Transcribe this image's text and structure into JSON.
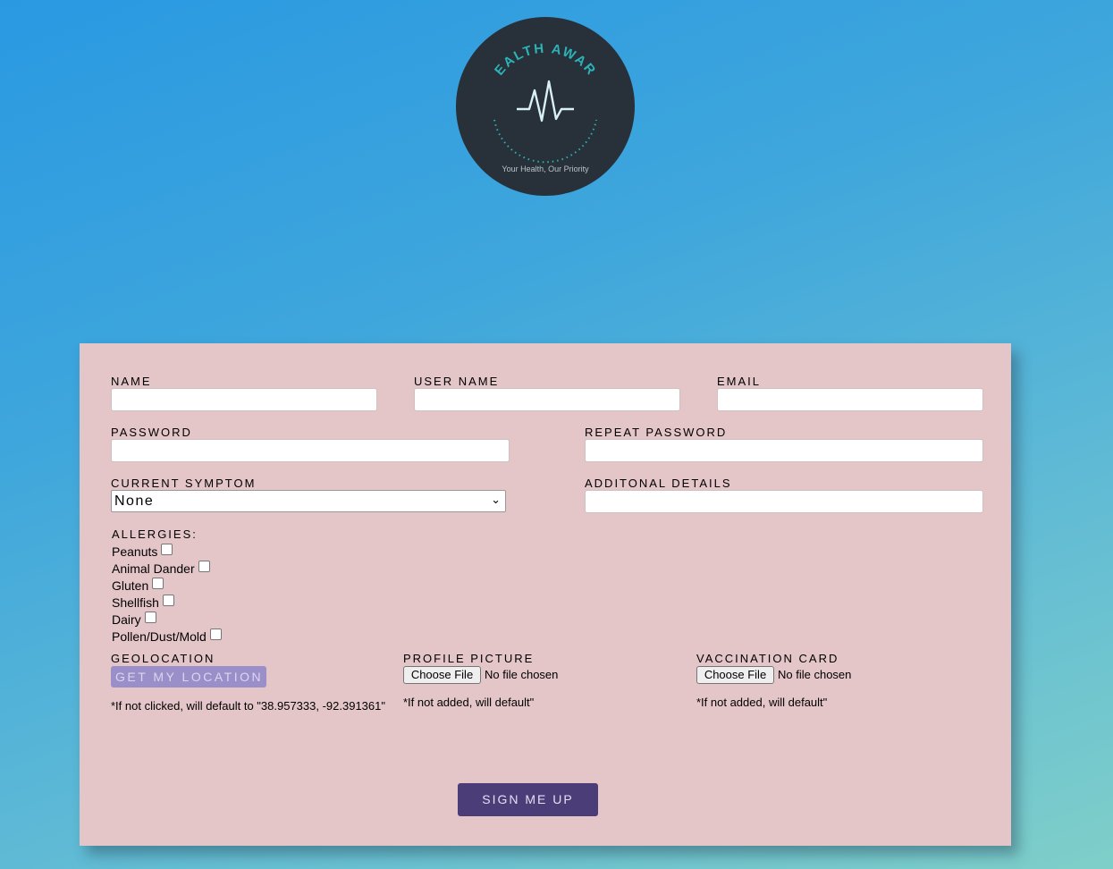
{
  "logo": {
    "arc_text": "HEALTH AWARE",
    "tagline": "Your Health, Our Priority"
  },
  "form": {
    "name_label": "NAME",
    "username_label": "USER NAME",
    "email_label": "EMAIL",
    "password_label": "PASSWORD",
    "repeat_password_label": "REPEAT PASSWORD",
    "symptom_label": "CURRENT SYMPTOM",
    "symptom_value": "None",
    "details_label": "ADDITONAL DETAILS",
    "allergies_label": "ALLERGIES:",
    "allergies": [
      {
        "label": "Peanuts",
        "checked": false
      },
      {
        "label": "Animal Dander",
        "checked": false
      },
      {
        "label": "Gluten",
        "checked": false
      },
      {
        "label": "Shellfish",
        "checked": false
      },
      {
        "label": "Dairy",
        "checked": false
      },
      {
        "label": "Pollen/Dust/Mold",
        "checked": false
      }
    ],
    "geo_label": "GEOLOCATION",
    "geo_button": "GET MY LOCATION",
    "geo_note": "*If not clicked, will default to \"38.957333, -92.391361\"",
    "profile_label": "PROFILE PICTURE",
    "profile_choose": "Choose File",
    "profile_status": "No file chosen",
    "profile_note": "*If not added, will default\"",
    "vacc_label": "VACCINATION CARD",
    "vacc_choose": "Choose File",
    "vacc_status": "No file chosen",
    "vacc_note": "*If not added, will default\"",
    "submit": "SIGN ME UP"
  },
  "colors": {
    "card": "#e4c5c8",
    "logo_bg": "#283039",
    "logo_accent": "#2bb3b8",
    "geo_button": "#9b8fca",
    "submit_button": "#4b3d78"
  }
}
